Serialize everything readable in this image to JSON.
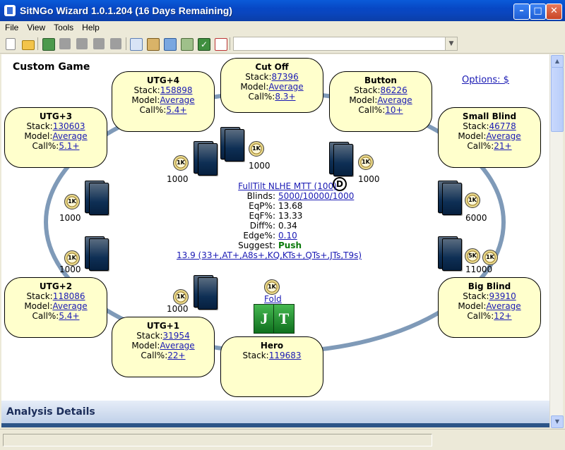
{
  "window": {
    "title": "SitNGo Wizard 1.0.1.204 (16 Days Remaining)"
  },
  "menu": [
    "File",
    "View",
    "Tools",
    "Help"
  ],
  "game": {
    "title": "Custom Game",
    "options_link": "Options: $",
    "labels": {
      "stack": "Stack:",
      "model": "Model:",
      "call": "Call%:"
    },
    "seats": [
      {
        "id": "cut-off",
        "name": "Cut Off",
        "stack": "87396",
        "model": "Average",
        "call": "8.3+"
      },
      {
        "id": "utg4",
        "name": "UTG+4",
        "stack": "158898",
        "model": "Average",
        "call": "5.4+"
      },
      {
        "id": "button",
        "name": "Button",
        "stack": "86226",
        "model": "Average",
        "call": "10+"
      },
      {
        "id": "utg3",
        "name": "UTG+3",
        "stack": "130603",
        "model": "Average",
        "call": "5.1+"
      },
      {
        "id": "small-blind",
        "name": "Small Blind",
        "stack": "46778",
        "model": "Average",
        "call": "21+"
      },
      {
        "id": "utg2",
        "name": "UTG+2",
        "stack": "118086",
        "model": "Average",
        "call": "5.4+"
      },
      {
        "id": "big-blind",
        "name": "Big Blind",
        "stack": "93910",
        "model": "Average",
        "call": "12+"
      },
      {
        "id": "utg1",
        "name": "UTG+1",
        "stack": "31954",
        "model": "Average",
        "call": "22+"
      },
      {
        "id": "hero",
        "name": "Hero",
        "stack": "119683"
      }
    ],
    "chip_bets": {
      "utg4": "1000",
      "cutoff": "1000",
      "button": "1000",
      "utg3": "1000",
      "small_blind": "6000",
      "utg2": "1000",
      "big_blind": "11000",
      "utg1": "1000"
    },
    "chip_marks": {
      "k1": "1K",
      "k5": "5K",
      "dealer": "D"
    },
    "info": {
      "tournament": "FullTilt NLHE MTT (100)",
      "blinds_label": "Blinds:",
      "blinds": "5000/10000/1000",
      "eqp_label": "EqP%:",
      "eqp": "13.68",
      "eqf_label": "EqF%:",
      "eqf": "13.33",
      "diff_label": "Diff%:",
      "diff": "0.34",
      "edge_label": "Edge%:",
      "edge": "0.10",
      "suggest_label": "Suggest:",
      "suggest": "Push",
      "range": "13.9 (33+,AT+,A8s+,KQ,KTs+,QTs+,JTs,T9s)"
    },
    "hero_action": "Fold",
    "hero_cards": [
      "J",
      "T"
    ],
    "colors": {
      "seat_fill": "#ffffcc",
      "table_rail": "#7f9ab8",
      "link": "#1a1ab4",
      "push": "#0a7a0a",
      "hero_card": "#2a9a38"
    }
  },
  "details": {
    "title": "Analysis Details"
  }
}
